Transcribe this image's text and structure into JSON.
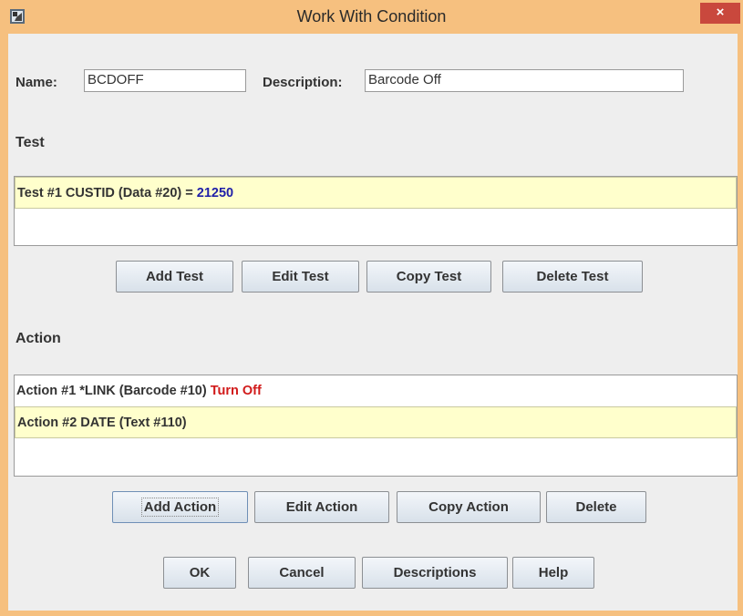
{
  "window": {
    "title": "Work With Condition",
    "close_label": "×"
  },
  "name_label": "Name:",
  "name_value": "BCDOFF",
  "description_label": "Description:",
  "description_value": "Barcode Off",
  "test_section": "Test",
  "tests": [
    {
      "prefix": "Test #1  CUSTID (Data #20) = ",
      "value": "21250"
    }
  ],
  "test_buttons": {
    "add": "Add Test",
    "edit": "Edit Test",
    "copy": "Copy Test",
    "delete": "Delete Test"
  },
  "action_section": "Action",
  "actions": [
    {
      "prefix": "Action #1 *LINK (Barcode #10) ",
      "value": "Turn Off"
    },
    {
      "prefix": "Action #2 DATE (Text #110)",
      "value": ""
    }
  ],
  "action_buttons": {
    "add": "Add Action",
    "edit": "Edit Action",
    "copy": "Copy Action",
    "delete": "Delete"
  },
  "bottom_buttons": {
    "ok": "OK",
    "cancel": "Cancel",
    "descriptions": "Descriptions",
    "help": "Help"
  },
  "colors": {
    "titlebar": "#f6c07f",
    "selected_row": "#ffffcc",
    "test_value": "#1f1fa8",
    "action_value": "#d11a1a"
  }
}
